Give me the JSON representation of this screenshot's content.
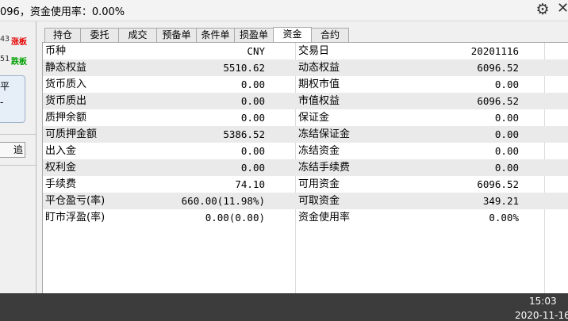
{
  "header": {
    "status_text": "096，资金使用率：0.00%"
  },
  "left_panel": {
    "limit_up_value": "43",
    "limit_up_label": "涨板",
    "limit_down_value": "51",
    "limit_down_label": "跌板",
    "box_top_text": "平",
    "box_bottom_text": "-",
    "chase_button_label": "追"
  },
  "tabs": [
    {
      "label": "持仓",
      "active": false
    },
    {
      "label": "委托",
      "active": false
    },
    {
      "label": "成交",
      "active": false
    },
    {
      "label": "预备单",
      "active": false
    },
    {
      "label": "条件单",
      "active": false
    },
    {
      "label": "损盈单",
      "active": false
    },
    {
      "label": "资金",
      "active": true
    },
    {
      "label": "合约",
      "active": false
    }
  ],
  "funds_table": {
    "rows": [
      {
        "label1": "币种",
        "value1": "CNY",
        "label2": "交易日",
        "value2": "20201116"
      },
      {
        "label1": "静态权益",
        "value1": "5510.62",
        "label2": "动态权益",
        "value2": "6096.52"
      },
      {
        "label1": "货币质入",
        "value1": "0.00",
        "label2": "期权市值",
        "value2": "0.00"
      },
      {
        "label1": "货币质出",
        "value1": "0.00",
        "label2": "市值权益",
        "value2": "6096.52"
      },
      {
        "label1": "质押余额",
        "value1": "0.00",
        "label2": "保证金",
        "value2": "0.00"
      },
      {
        "label1": "可质押金额",
        "value1": "5386.52",
        "label2": "冻结保证金",
        "value2": "0.00"
      },
      {
        "label1": "出入金",
        "value1": "0.00",
        "label2": "冻结资金",
        "value2": "0.00"
      },
      {
        "label1": "权利金",
        "value1": "0.00",
        "label2": "冻结手续费",
        "value2": "0.00"
      },
      {
        "label1": "手续费",
        "value1": "74.10",
        "label2": "可用资金",
        "value2": "6096.52"
      },
      {
        "label1": "平仓盈亏(率)",
        "value1": "660.00(11.98%)",
        "label2": "可取资金",
        "value2": "349.21"
      },
      {
        "label1": "盯市浮盈(率)",
        "value1": "0.00(0.00)",
        "label2": "资金使用率",
        "value2": "0.00%"
      }
    ]
  },
  "taskbar": {
    "time": "15:03",
    "date": "2020-11-16"
  },
  "colors": {
    "limit_up": "#e60000",
    "limit_down": "#00a000",
    "row_alt": "#eaeaea",
    "taskbar": "#3c3c3c"
  },
  "icons": {
    "settings": "gear-icon",
    "close": "close-icon"
  }
}
